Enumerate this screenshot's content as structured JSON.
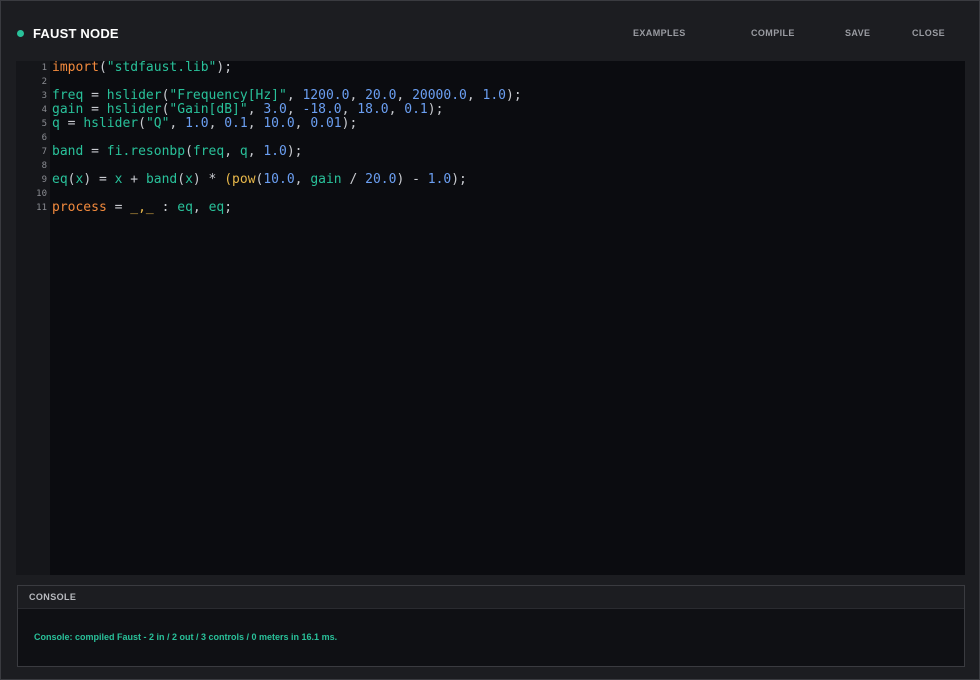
{
  "app": {
    "title": "FAUST NODE",
    "status_color": "#29c19a"
  },
  "menu": {
    "examples": "EXAMPLES",
    "compile": "COMPILE",
    "save": "SAVE",
    "close": "CLOSE"
  },
  "editor": {
    "line_numbers": [
      "1",
      "2",
      "3",
      "4",
      "5",
      "6",
      "7",
      "8",
      "9",
      "10",
      "11"
    ],
    "lines": [
      [
        {
          "t": "import",
          "c": "kw"
        },
        {
          "t": "(",
          "c": "paren"
        },
        {
          "t": "\"stdfaust.lib\"",
          "c": "str"
        },
        {
          "t": ");",
          "c": "op"
        }
      ],
      [],
      [
        {
          "t": "freq",
          "c": "id"
        },
        {
          "t": " = ",
          "c": "op"
        },
        {
          "t": "hslider",
          "c": "id"
        },
        {
          "t": "(",
          "c": "paren"
        },
        {
          "t": "\"Frequency[Hz]\"",
          "c": "str"
        },
        {
          "t": ", ",
          "c": "op"
        },
        {
          "t": "1200.0",
          "c": "num"
        },
        {
          "t": ", ",
          "c": "op"
        },
        {
          "t": "20.0",
          "c": "num"
        },
        {
          "t": ", ",
          "c": "op"
        },
        {
          "t": "20000.0",
          "c": "num"
        },
        {
          "t": ", ",
          "c": "op"
        },
        {
          "t": "1.0",
          "c": "num"
        },
        {
          "t": ");",
          "c": "op"
        }
      ],
      [
        {
          "t": "gain",
          "c": "id"
        },
        {
          "t": " = ",
          "c": "op"
        },
        {
          "t": "hslider",
          "c": "id"
        },
        {
          "t": "(",
          "c": "paren"
        },
        {
          "t": "\"Gain[dB]\"",
          "c": "str"
        },
        {
          "t": ", ",
          "c": "op"
        },
        {
          "t": "3.0",
          "c": "num"
        },
        {
          "t": ", ",
          "c": "op"
        },
        {
          "t": "-18.0",
          "c": "num"
        },
        {
          "t": ", ",
          "c": "op"
        },
        {
          "t": "18.0",
          "c": "num"
        },
        {
          "t": ", ",
          "c": "op"
        },
        {
          "t": "0.1",
          "c": "num"
        },
        {
          "t": ");",
          "c": "op"
        }
      ],
      [
        {
          "t": "q",
          "c": "id"
        },
        {
          "t": " = ",
          "c": "op"
        },
        {
          "t": "hslider",
          "c": "id"
        },
        {
          "t": "(",
          "c": "paren"
        },
        {
          "t": "\"Q\"",
          "c": "str"
        },
        {
          "t": ", ",
          "c": "op"
        },
        {
          "t": "1.0",
          "c": "num"
        },
        {
          "t": ", ",
          "c": "op"
        },
        {
          "t": "0.1",
          "c": "num"
        },
        {
          "t": ", ",
          "c": "op"
        },
        {
          "t": "10.0",
          "c": "num"
        },
        {
          "t": ", ",
          "c": "op"
        },
        {
          "t": "0.01",
          "c": "num"
        },
        {
          "t": ");",
          "c": "op"
        }
      ],
      [],
      [
        {
          "t": "band",
          "c": "id"
        },
        {
          "t": " = ",
          "c": "op"
        },
        {
          "t": "fi.resonbp",
          "c": "id"
        },
        {
          "t": "(",
          "c": "paren"
        },
        {
          "t": "freq",
          "c": "id"
        },
        {
          "t": ", ",
          "c": "op"
        },
        {
          "t": "q",
          "c": "id"
        },
        {
          "t": ", ",
          "c": "op"
        },
        {
          "t": "1.0",
          "c": "num"
        },
        {
          "t": ");",
          "c": "op"
        }
      ],
      [],
      [
        {
          "t": "eq",
          "c": "id"
        },
        {
          "t": "(",
          "c": "paren"
        },
        {
          "t": "x",
          "c": "id"
        },
        {
          "t": ")",
          "c": "paren"
        },
        {
          "t": " = ",
          "c": "op"
        },
        {
          "t": "x",
          "c": "id"
        },
        {
          "t": " + ",
          "c": "op"
        },
        {
          "t": "band",
          "c": "id"
        },
        {
          "t": "(",
          "c": "paren"
        },
        {
          "t": "x",
          "c": "id"
        },
        {
          "t": ")",
          "c": "paren"
        },
        {
          "t": " * ",
          "c": "op"
        },
        {
          "t": "(",
          "c": "fn"
        },
        {
          "t": "pow",
          "c": "fn"
        },
        {
          "t": "(",
          "c": "paren"
        },
        {
          "t": "10.0",
          "c": "num"
        },
        {
          "t": ", ",
          "c": "op"
        },
        {
          "t": "gain",
          "c": "id"
        },
        {
          "t": " / ",
          "c": "op"
        },
        {
          "t": "20.0",
          "c": "num"
        },
        {
          "t": ")",
          "c": "paren"
        },
        {
          "t": " - ",
          "c": "op"
        },
        {
          "t": "1.0",
          "c": "num"
        },
        {
          "t": ");",
          "c": "op"
        }
      ],
      [],
      [
        {
          "t": "process",
          "c": "kw"
        },
        {
          "t": " = ",
          "c": "op"
        },
        {
          "t": "_,_",
          "c": "fn"
        },
        {
          "t": " : ",
          "c": "op"
        },
        {
          "t": "eq",
          "c": "id"
        },
        {
          "t": ", ",
          "c": "op"
        },
        {
          "t": "eq",
          "c": "id"
        },
        {
          "t": ";",
          "c": "op"
        }
      ]
    ]
  },
  "console": {
    "title": "CONSOLE",
    "message": "Console: compiled Faust - 2 in / 2 out / 3 controls / 0 meters in 16.1 ms.",
    "message_color": "#29c19a"
  }
}
